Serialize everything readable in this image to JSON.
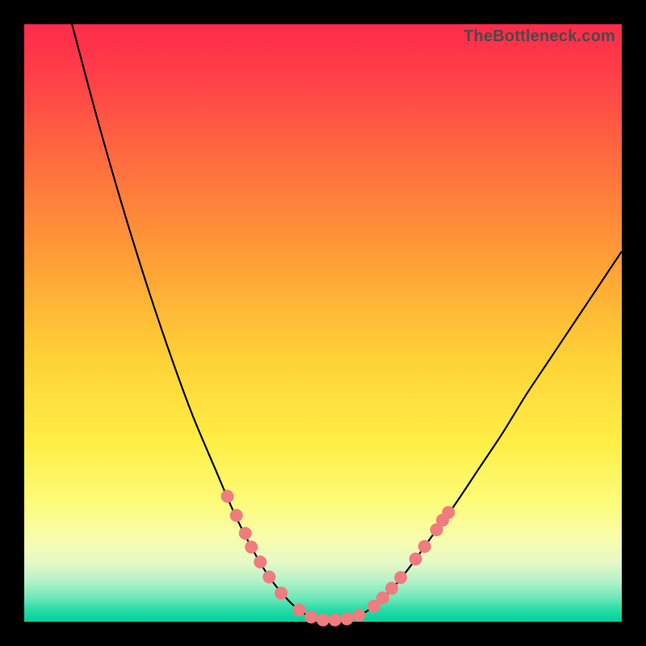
{
  "watermark": "TheBottleneck.com",
  "chart_data": {
    "type": "line",
    "title": "",
    "xlabel": "",
    "ylabel": "",
    "xlim": [
      0,
      100
    ],
    "ylim": [
      0,
      100
    ],
    "curve": {
      "name": "bottleneck-curve",
      "points": [
        {
          "x": 8.0,
          "y": 100.0
        },
        {
          "x": 12.0,
          "y": 85.0
        },
        {
          "x": 16.0,
          "y": 71.0
        },
        {
          "x": 20.0,
          "y": 58.0
        },
        {
          "x": 24.0,
          "y": 46.0
        },
        {
          "x": 28.0,
          "y": 35.0
        },
        {
          "x": 32.0,
          "y": 25.5
        },
        {
          "x": 35.0,
          "y": 18.5
        },
        {
          "x": 38.0,
          "y": 12.5
        },
        {
          "x": 41.0,
          "y": 7.5
        },
        {
          "x": 44.0,
          "y": 3.8
        },
        {
          "x": 46.5,
          "y": 1.6
        },
        {
          "x": 49.0,
          "y": 0.5
        },
        {
          "x": 51.5,
          "y": 0.3
        },
        {
          "x": 54.0,
          "y": 0.5
        },
        {
          "x": 56.5,
          "y": 1.3
        },
        {
          "x": 59.0,
          "y": 3.0
        },
        {
          "x": 62.0,
          "y": 6.0
        },
        {
          "x": 65.0,
          "y": 9.8
        },
        {
          "x": 68.0,
          "y": 14.0
        },
        {
          "x": 72.0,
          "y": 19.5
        },
        {
          "x": 76.0,
          "y": 25.5
        },
        {
          "x": 80.0,
          "y": 31.5
        },
        {
          "x": 84.0,
          "y": 38.0
        },
        {
          "x": 88.0,
          "y": 44.0
        },
        {
          "x": 92.0,
          "y": 50.0
        },
        {
          "x": 96.0,
          "y": 56.0
        },
        {
          "x": 100.0,
          "y": 62.0
        }
      ]
    },
    "markers": [
      {
        "x": 34.0,
        "y": 21.0
      },
      {
        "x": 35.5,
        "y": 17.8
      },
      {
        "x": 37.0,
        "y": 14.8
      },
      {
        "x": 38.0,
        "y": 12.5
      },
      {
        "x": 39.5,
        "y": 10.0
      },
      {
        "x": 41.0,
        "y": 7.5
      },
      {
        "x": 43.0,
        "y": 4.8
      },
      {
        "x": 46.0,
        "y": 2.0
      },
      {
        "x": 48.0,
        "y": 0.8
      },
      {
        "x": 50.0,
        "y": 0.3
      },
      {
        "x": 52.0,
        "y": 0.3
      },
      {
        "x": 54.0,
        "y": 0.5
      },
      {
        "x": 56.0,
        "y": 1.1
      },
      {
        "x": 58.5,
        "y": 2.6
      },
      {
        "x": 60.0,
        "y": 4.0
      },
      {
        "x": 61.5,
        "y": 5.6
      },
      {
        "x": 63.0,
        "y": 7.4
      },
      {
        "x": 65.5,
        "y": 10.5
      },
      {
        "x": 67.0,
        "y": 12.6
      },
      {
        "x": 69.0,
        "y": 15.4
      },
      {
        "x": 70.0,
        "y": 17.0
      },
      {
        "x": 71.0,
        "y": 18.3
      }
    ]
  },
  "colors": {
    "curve": "#000000",
    "marker": "#ef7c7f",
    "bg_top": "#ff2b4a",
    "bg_bottom": "#00d19a"
  }
}
